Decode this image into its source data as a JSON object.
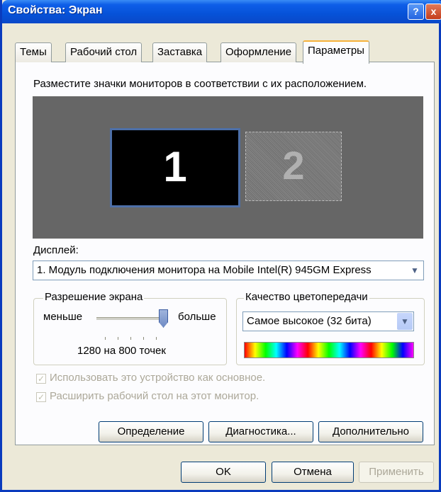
{
  "window": {
    "title": "Свойства: Экран",
    "help_label": "?",
    "close_label": "x"
  },
  "tabs": [
    {
      "label": "Темы"
    },
    {
      "label": "Рабочий стол"
    },
    {
      "label": "Заставка"
    },
    {
      "label": "Оформление"
    },
    {
      "label": "Параметры",
      "active": true
    }
  ],
  "monitors": {
    "instruction": "Разместите значки мониторов в соответствии с их расположением.",
    "primary_label": "1",
    "secondary_label": "2"
  },
  "display": {
    "label": "Дисплей:",
    "value": "1. Модуль подключения монитора на Mobile Intel(R) 945GM Express"
  },
  "resolution": {
    "legend": "Разрешение экрана",
    "less_label": "меньше",
    "more_label": "больше",
    "value_text": "1280 на 800 точек",
    "slider_level": 1.0
  },
  "color_quality": {
    "legend": "Качество цветопередачи",
    "value": "Самое высокое (32 бита)"
  },
  "options": {
    "primary_device": "Использовать это устройство как основное.",
    "extend_desktop": "Расширить рабочий стол на этот монитор."
  },
  "buttons": {
    "identify": "Определение",
    "troubleshoot": "Диагностика...",
    "advanced": "Дополнительно",
    "ok": "OK",
    "cancel": "Отмена",
    "apply": "Применить"
  },
  "colors": {
    "titlebar": "#0652d8",
    "monitor_area": "#666666",
    "dialog_bg": "#ece9d8"
  }
}
